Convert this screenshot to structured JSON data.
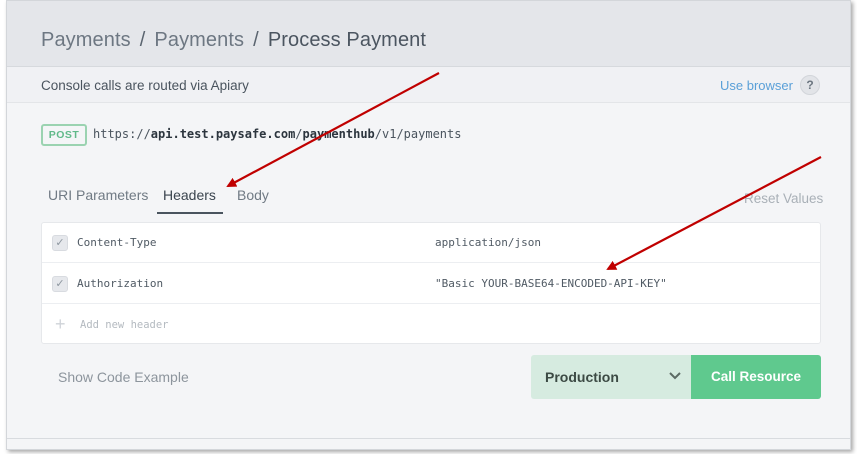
{
  "breadcrumb": {
    "items": [
      "Payments",
      "Payments",
      "Process Payment"
    ],
    "separator": "/"
  },
  "notice": {
    "text": "Console calls are routed via Apiary",
    "use_browser": "Use browser",
    "help": "?"
  },
  "request": {
    "method": "POST",
    "url_prefix": "https://",
    "url_host": "api.test.paysafe.com",
    "url_sep1": "/",
    "url_path_bold": "paymenthub",
    "url_rest": "/v1/payments"
  },
  "tabs": {
    "items": [
      "URI Parameters",
      "Headers",
      "Body"
    ],
    "active": "Headers",
    "reset_values": "Reset Values"
  },
  "headers": {
    "rows": [
      {
        "key": "Content-Type",
        "value": "application/json",
        "checked": true
      },
      {
        "key": "Authorization",
        "value": "\"Basic YOUR-BASE64-ENCODED-API-KEY\"",
        "checked": true
      }
    ],
    "add_placeholder": "Add new header"
  },
  "footer": {
    "show_code": "Show Code Example",
    "environment": "Production",
    "call_resource": "Call Resource"
  },
  "colors": {
    "annotation_arrow": "#c00000",
    "call_button": "#5fc98e",
    "env_select": "#d6ebe0",
    "link": "#5aa0d8"
  },
  "icons": {
    "help": "help-circle-icon",
    "checkbox": "check-icon",
    "add": "plus-icon",
    "dropdown": "chevron-down-icon"
  }
}
